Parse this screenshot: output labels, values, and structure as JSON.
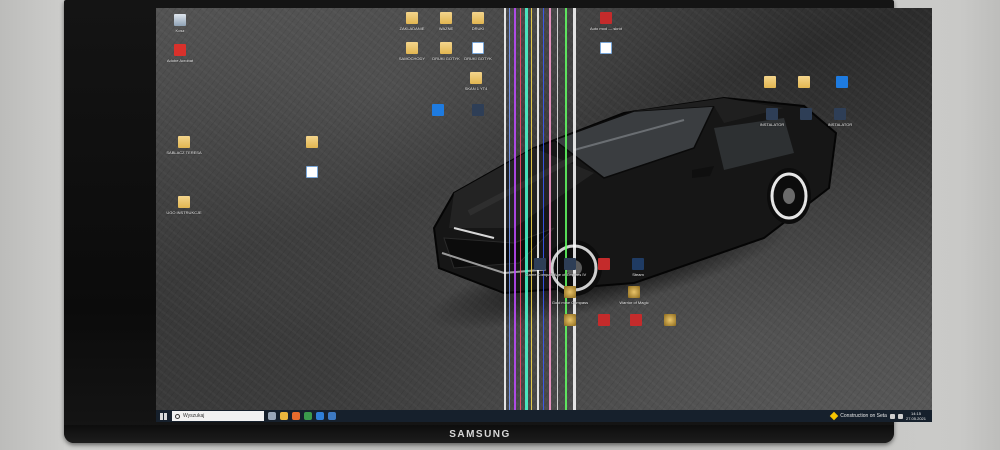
{
  "monitor": {
    "brand": "SAMSUNG"
  },
  "desktop_icons": [
    {
      "id": "recycle",
      "label": "Kosz",
      "kind": "bin"
    },
    {
      "id": "acrobat",
      "label": "Adobe Acrobat",
      "kind": "pdf"
    },
    {
      "id": "sablacz",
      "label": "SABLACZ TERESA",
      "kind": "folder"
    },
    {
      "id": "ugo",
      "label": "UGO INSTRUKCJE",
      "kind": "folder"
    },
    {
      "id": "f1",
      "label": "ZAKLADANIE",
      "kind": "folder"
    },
    {
      "id": "f2",
      "label": "WAZNE",
      "kind": "folder"
    },
    {
      "id": "f3",
      "label": "DRUKI",
      "kind": "folder"
    },
    {
      "id": "f4",
      "label": "SAMOCHODY",
      "kind": "folder"
    },
    {
      "id": "f5",
      "label": "DRUKI GOTYK",
      "kind": "folder"
    },
    {
      "id": "f6",
      "label": "DRUKI GOTYK",
      "kind": "doc"
    },
    {
      "id": "f7",
      "label": "SKAN 1 YT4",
      "kind": "folder"
    },
    {
      "id": "app1",
      "label": "",
      "kind": "blue"
    },
    {
      "id": "app2",
      "label": "",
      "kind": "game"
    },
    {
      "id": "f8",
      "label": "",
      "kind": "folder"
    },
    {
      "id": "doc2",
      "label": "",
      "kind": "doc"
    },
    {
      "id": "autos",
      "label": "Auto mod — skrót",
      "kind": "red"
    },
    {
      "id": "pdf2",
      "label": "",
      "kind": "doc"
    },
    {
      "id": "f9",
      "label": "",
      "kind": "folder"
    },
    {
      "id": "f10",
      "label": "",
      "kind": "folder"
    },
    {
      "id": "edge",
      "label": "",
      "kind": "blue"
    },
    {
      "id": "inst1",
      "label": "INSTALATOR",
      "kind": "game"
    },
    {
      "id": "inst2",
      "label": "",
      "kind": "game"
    },
    {
      "id": "inst3",
      "label": "INSTALATOR",
      "kind": "game"
    },
    {
      "id": "game1",
      "label": "Game Compass",
      "kind": "game"
    },
    {
      "id": "game2",
      "label": "Age of Empires IV",
      "kind": "game"
    },
    {
      "id": "game3",
      "label": "",
      "kind": "red"
    },
    {
      "id": "steam",
      "label": "Steam",
      "kind": "steam"
    },
    {
      "id": "game4",
      "label": "Gold mine Compass",
      "kind": "gold"
    },
    {
      "id": "game5",
      "label": "Warrior of Magic",
      "kind": "gold"
    },
    {
      "id": "game6",
      "label": "",
      "kind": "gold"
    },
    {
      "id": "game7",
      "label": "",
      "kind": "red"
    },
    {
      "id": "game8",
      "label": "",
      "kind": "red"
    },
    {
      "id": "game9",
      "label": "",
      "kind": "gold"
    }
  ],
  "taskbar": {
    "search_placeholder": "Wyszukaj",
    "apps": [
      {
        "name": "task-view",
        "color": "#9aa7b8"
      },
      {
        "name": "explorer",
        "color": "#e8b53d"
      },
      {
        "name": "firefox",
        "color": "#e66b2d"
      },
      {
        "name": "chrome",
        "color": "#3b9b4b"
      },
      {
        "name": "store",
        "color": "#2f7fd8"
      },
      {
        "name": "mail",
        "color": "#3d79c2"
      }
    ],
    "notification": "Construction on Seta",
    "clock_time": "14:15",
    "clock_date": "27.05.2021"
  },
  "glitch_colors": [
    "#ffffff",
    "#7aa0ff",
    "#c04aff",
    "#ff4a6a",
    "#4affd2",
    "#ffe14a",
    "#ffffff",
    "#3a5cff",
    "#ff9bd1",
    "#e8e8e8",
    "#62ff62",
    "#ffffff"
  ]
}
